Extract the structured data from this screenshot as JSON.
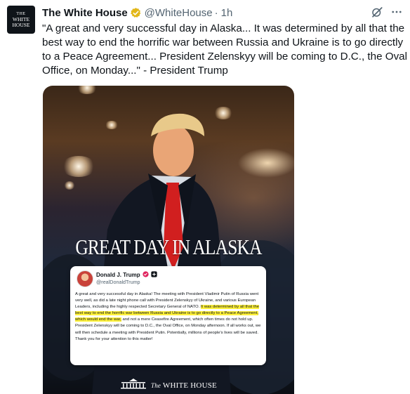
{
  "account": {
    "avatar_text": [
      "THE",
      "WHITE",
      "HOUSE"
    ],
    "name": "The White House",
    "handle": "@WhiteHouse",
    "separator": "·",
    "time": "1h"
  },
  "tweet": {
    "text": "\"A great and very successful day in Alaska... It was determined by all that the best way to end the horrific war between Russia and Ukraine is to go directly to a Peace Agreement... President Zelenskyy will be coming to D.C., the Oval Office, on Monday...\" - President Trump"
  },
  "media": {
    "headline": "GREAT DAY IN ALASKA",
    "embedded_post": {
      "name": "Donald J. Trump",
      "handle": "@realDonaldTrump",
      "body_part1": "A great and very successful day in Alaska! The meeting with President Vladimir Putin of Russia went very well, as did a late night phone call with President Zelenskyy of Ukraine, and various European Leaders, including the highly respected Secretary General of NATO.",
      "body_highlight": "It was determined by all that the best way to end the horrific war between Russia and Ukraine is to go directly to a Peace Agreement, which would end the war,",
      "body_part2": "and not a mere Ceasefire Agreement, which often times do not hold up. President Zelenskyy will be coming to D.C., the Oval Office, on Monday afternoon. If all works out, we will then schedule a meeting with President Putin. Potentially, millions of people's lives will be saved. Thank you for your attention to this matter!"
    },
    "footer_prefix": "The",
    "footer_text": "WHITE HOUSE"
  },
  "colors": {
    "verified_gold": "#e2b719",
    "text": "#0f1419",
    "muted": "#536471",
    "highlight": "#fff23b"
  },
  "icons": [
    "verified-badge-icon",
    "grok-icon",
    "more-icon",
    "white-house-logo-icon"
  ]
}
